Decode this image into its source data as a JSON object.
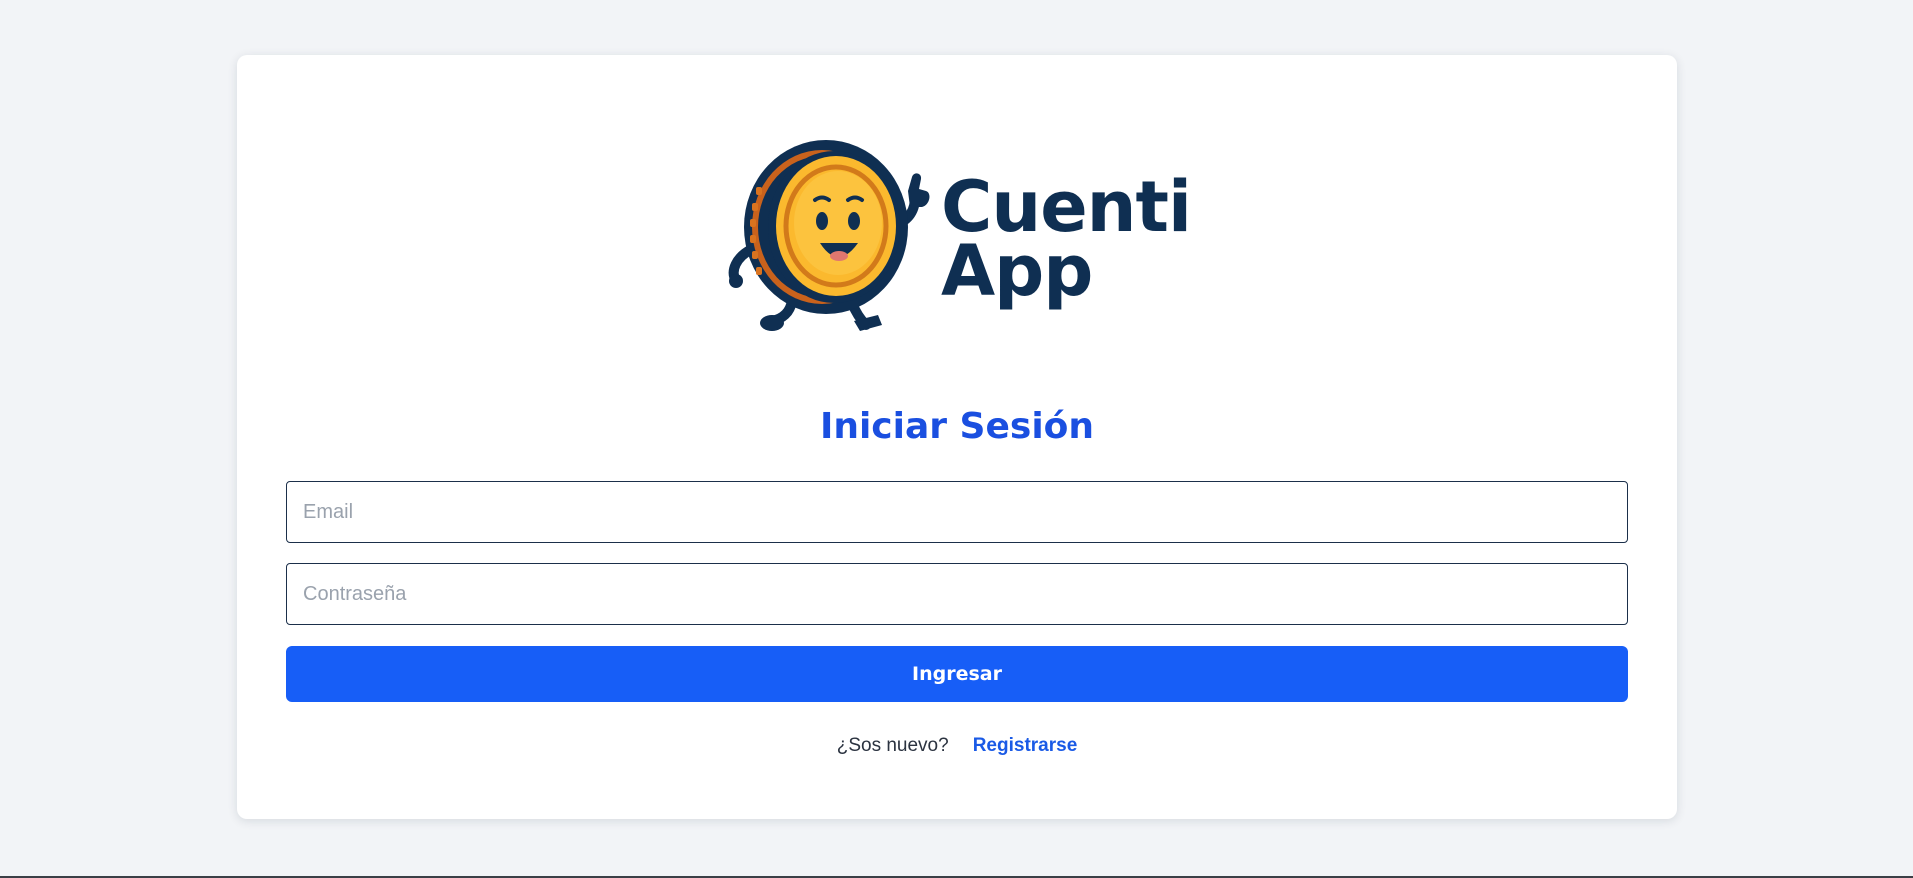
{
  "brand": {
    "name_line1": "Cuenti",
    "name_line2": "App",
    "logo_icon": "coin-mascot-icon",
    "colors": {
      "navy": "#0f2f52",
      "coin": "#fbb92e",
      "coin_ring": "#d27a1a"
    }
  },
  "login": {
    "title": "Iniciar Sesión",
    "email_placeholder": "Email",
    "email_value": "",
    "password_placeholder": "Contraseña",
    "password_value": "",
    "submit_label": "Ingresar",
    "new_user_text": "¿Sos nuevo?",
    "register_link": "Registrarse"
  },
  "theme": {
    "accent": "#175ef7",
    "title_color": "#1a4fe0",
    "background": "#f2f4f7"
  }
}
